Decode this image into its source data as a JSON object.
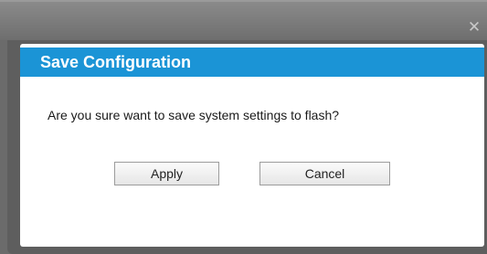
{
  "window": {
    "close_glyph": "✕"
  },
  "dialog": {
    "title": "Save Configuration",
    "message": "Are you sure want to save system settings to flash?",
    "apply_label": "Apply",
    "cancel_label": "Cancel"
  },
  "colors": {
    "header_blue": "#1b94d6",
    "backdrop_gray": "#6b6b6b"
  },
  "icons": {
    "close": "close-icon"
  }
}
